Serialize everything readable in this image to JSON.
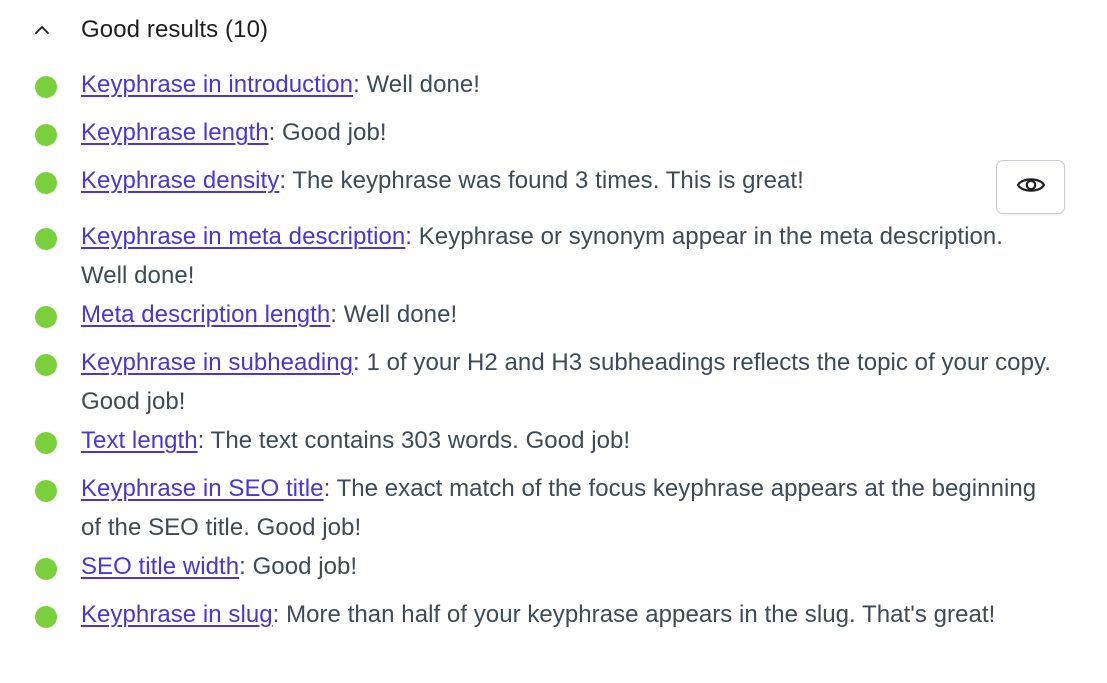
{
  "section": {
    "title": "Good results (10)",
    "chevron_icon": "chevron-up-icon",
    "bullet_color": "#7ad03a",
    "link_color": "#4b35d4"
  },
  "results": [
    {
      "link": "Keyphrase in introduction",
      "text": ": Well done!"
    },
    {
      "link": "Keyphrase length",
      "text": ": Good job!"
    },
    {
      "link": "Keyphrase density",
      "text": ": The keyphrase was found 3 times. This is great!"
    },
    {
      "link": "Keyphrase in meta description",
      "text": ": Keyphrase or synonym appear in the meta description. Well done!"
    },
    {
      "link": "Meta description length",
      "text": ": Well done!"
    },
    {
      "link": "Keyphrase in subheading",
      "text": ": 1 of your H2 and H3 subheadings reflects the topic of your copy. Good job!"
    },
    {
      "link": "Text length",
      "text": ": The text contains 303 words. Good job!"
    },
    {
      "link": "Keyphrase in SEO title",
      "text": ": The exact match of the focus keyphrase appears at the beginning of the SEO title. Good job!"
    },
    {
      "link": "SEO title width",
      "text": ": Good job!"
    },
    {
      "link": "Keyphrase in slug",
      "text": ": More than half of your keyphrase appears in the slug. That's great!"
    }
  ],
  "highlight_button": {
    "icon": "eye-icon"
  }
}
